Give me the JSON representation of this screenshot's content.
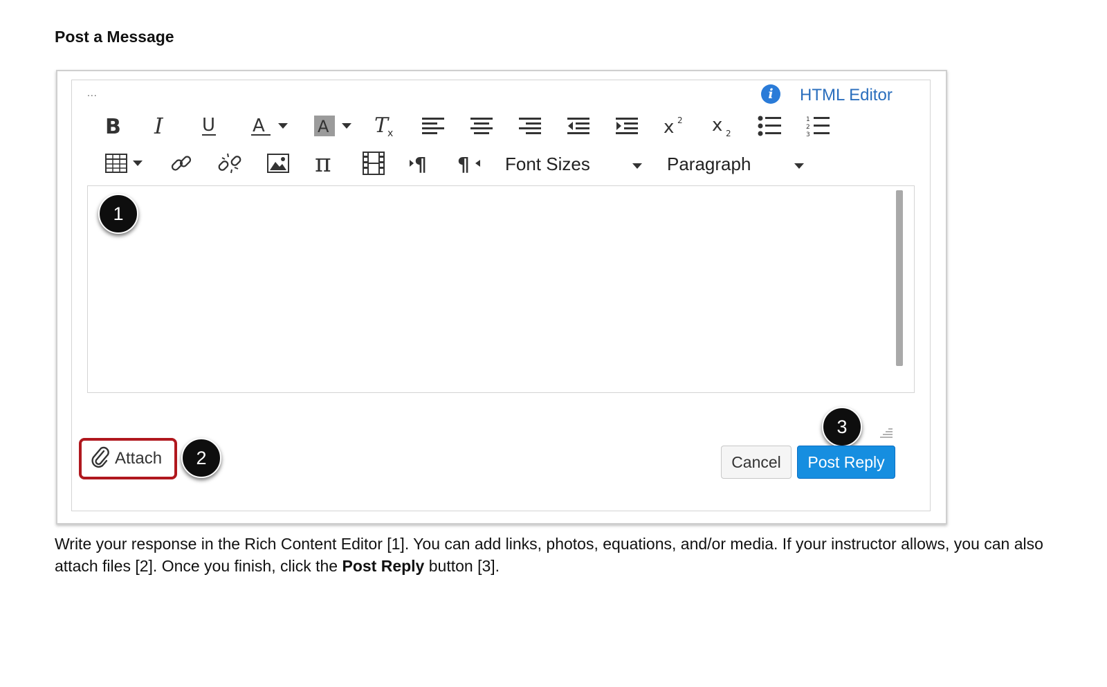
{
  "heading": "Post a Message",
  "editor": {
    "menu_dots": "...",
    "html_editor_link": "HTML Editor",
    "info_icon_glyph": "i",
    "font_sizes_label": "Font Sizes",
    "paragraph_label": "Paragraph",
    "toolbar_row1_icons": [
      "bold-icon",
      "italic-icon",
      "underline-icon",
      "text-color-icon",
      "background-color-icon",
      "clear-formatting-icon",
      "align-left-icon",
      "align-center-icon",
      "align-right-icon",
      "outdent-icon",
      "indent-icon",
      "superscript-icon",
      "subscript-icon",
      "bullet-list-icon",
      "numbered-list-icon"
    ],
    "toolbar_row2_icons": [
      "table-icon",
      "link-icon",
      "unlink-icon",
      "image-icon",
      "equation-icon",
      "media-icon",
      "ltr-paragraph-icon",
      "rtl-paragraph-icon"
    ]
  },
  "buttons": {
    "attach_label": "Attach",
    "cancel_label": "Cancel",
    "post_reply_label": "Post Reply"
  },
  "callouts": {
    "one": "1",
    "two": "2",
    "three": "3"
  },
  "description": {
    "part1": "Write your response in the Rich Content Editor [1]. You can add links, photos, equations, and/or media. If your instructor allows, you can also attach files [2]. Once you finish, click the ",
    "bold": "Post Reply",
    "part2": " button [3]."
  },
  "colors": {
    "accent_blue": "#168ee0",
    "link_blue": "#2a6ebd",
    "highlight_red": "#b0181e",
    "callout_black": "#0e0e0e"
  }
}
